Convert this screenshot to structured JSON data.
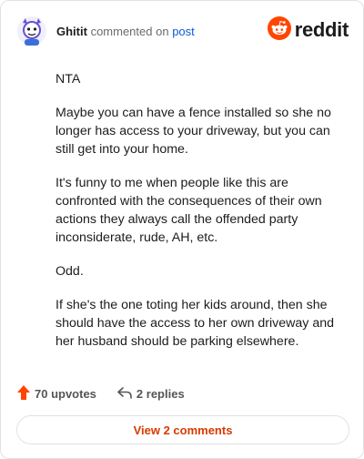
{
  "header": {
    "author": "Ghitit",
    "action_text": "commented on",
    "post_link": "post",
    "brand": "reddit"
  },
  "comment": {
    "paragraphs": [
      "NTA",
      "Maybe you can have a fence installed so she no longer has access to your driveway, but you can still get into your home.",
      "It's funny to me when people like this are confronted with the consequences of their own actions they always call the offended party inconsiderate, rude, AH, etc.",
      "Odd.",
      "If she's the one toting her kids around, then she should have the access to her own driveway and her husband should be parking elsewhere."
    ]
  },
  "actions": {
    "upvotes": "70 upvotes",
    "replies": "2 replies"
  },
  "footer": {
    "view_comments": "View 2 comments"
  },
  "colors": {
    "accent": "#ff4500",
    "link": "#0a5bd6",
    "view_button_text": "#d93a00"
  },
  "icons": [
    "avatar-icon",
    "reddit-logo-icon",
    "upvote-icon",
    "reply-icon"
  ]
}
